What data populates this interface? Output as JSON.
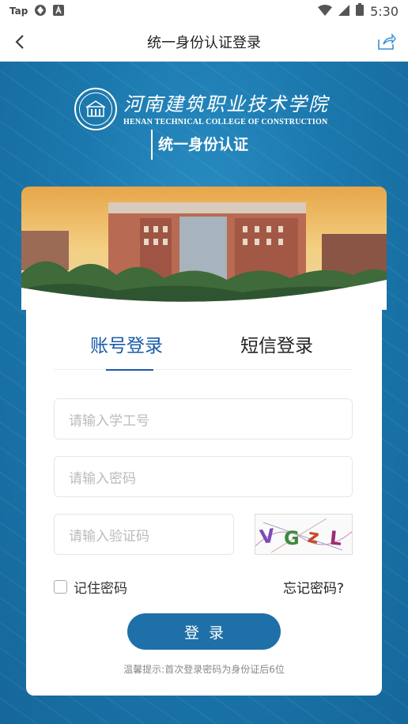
{
  "status_bar": {
    "app_label": "Tap",
    "time": "5:30"
  },
  "app_bar": {
    "title": "统一身份认证登录"
  },
  "header": {
    "school_name_cn": "河南建筑职业技术学院",
    "school_name_en": "HENAN TECHNICAL COLLEGE OF CONSTRUCTION",
    "system_title": "统一身份认证"
  },
  "tabs": {
    "account": "账号登录",
    "sms": "短信登录"
  },
  "form": {
    "username_placeholder": "请输入学工号",
    "password_placeholder": "请输入密码",
    "captcha_placeholder": "请输入验证码",
    "captcha_text": "VGzL",
    "remember_label": "记住密码",
    "forgot_label": "忘记密码?",
    "login_label": "登录"
  },
  "tip": "温馨提示:首次登录密码为身份证后6位",
  "colors": {
    "primary": "#1f70a8",
    "tab_active": "#1a5aa8",
    "background": "#1a73a8"
  }
}
